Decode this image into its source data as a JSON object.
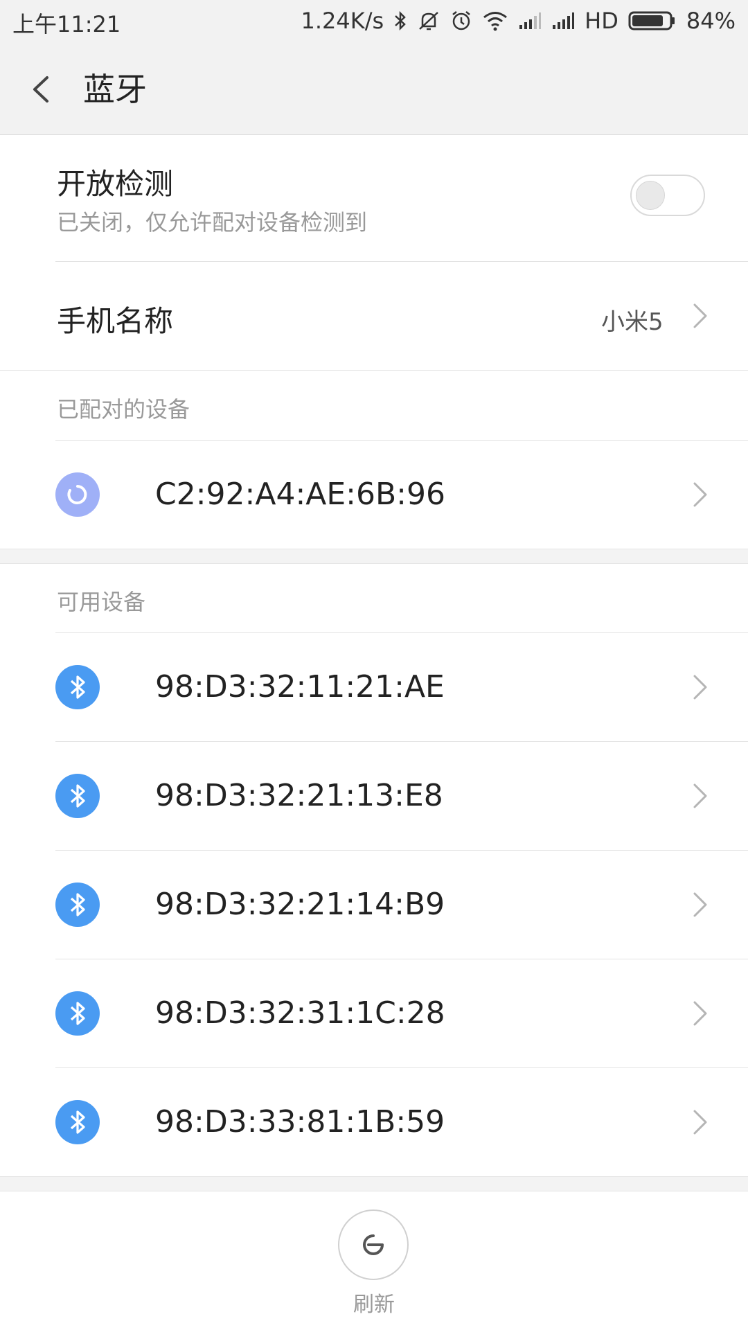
{
  "status": {
    "time": "上午11:21",
    "net_speed": "1.24K/s",
    "network_type": "HD",
    "battery": "84%",
    "battery_level": 0.84
  },
  "header": {
    "title": "蓝牙",
    "back_icon": "chevron-left-icon"
  },
  "discoverable": {
    "label": "开放检测",
    "sub": "已关闭，仅允许配对设备检测到",
    "enabled": false
  },
  "device_name": {
    "label": "手机名称",
    "value": "小米5"
  },
  "paired": {
    "title": "已配对的设备",
    "devices": [
      {
        "name": "C2:92:A4:AE:6B:96",
        "icon": "connecting-icon"
      }
    ]
  },
  "available": {
    "title": "可用设备",
    "devices": [
      {
        "name": "98:D3:32:11:21:AE",
        "icon": "bluetooth-icon"
      },
      {
        "name": "98:D3:32:21:13:E8",
        "icon": "bluetooth-icon"
      },
      {
        "name": "98:D3:32:21:14:B9",
        "icon": "bluetooth-icon"
      },
      {
        "name": "98:D3:32:31:1C:28",
        "icon": "bluetooth-icon"
      },
      {
        "name": "98:D3:33:81:1B:59",
        "icon": "bluetooth-icon"
      }
    ]
  },
  "refresh": {
    "label": "刷新",
    "icon": "refresh-icon"
  },
  "colors": {
    "header_bg": "#f2f2f2",
    "bluetooth_blue": "#4a9bf2",
    "paired_icon": "#9fb0f7",
    "secondary_text": "#999999"
  }
}
